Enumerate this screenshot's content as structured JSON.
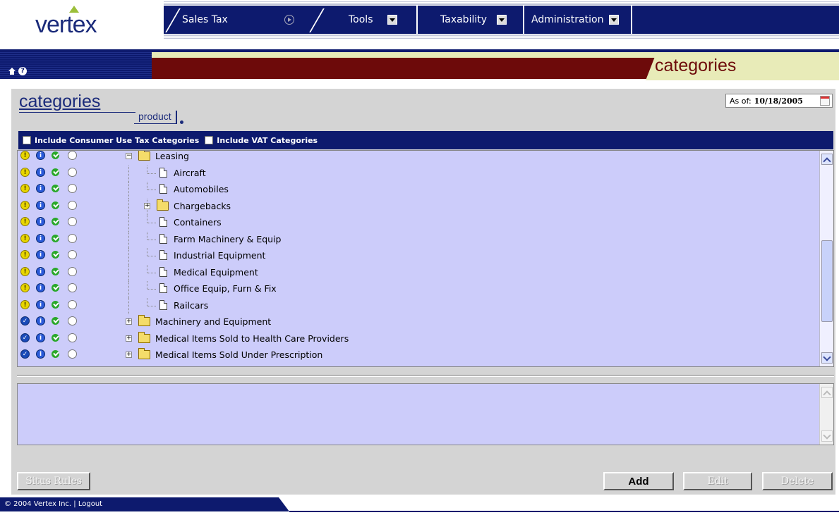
{
  "app": {
    "logo": "vertex"
  },
  "nav": {
    "items": [
      {
        "label": "Sales Tax",
        "icon": "play-circle-icon"
      },
      {
        "label": "Tools",
        "icon": "dropdown-arrow-icon"
      },
      {
        "label": "Taxability",
        "icon": "dropdown-arrow-icon"
      },
      {
        "label": "Administration",
        "icon": "dropdown-arrow-icon"
      }
    ]
  },
  "section_tab": "categories",
  "page": {
    "title": "categories",
    "subtitle": "product",
    "as_of_label": "As of:",
    "as_of_date": "10/18/2005"
  },
  "filters": {
    "consumer_use": "Include Consumer Use Tax Categories",
    "vat": "Include VAT Categories"
  },
  "tree": {
    "rows": [
      {
        "label": "Leasing",
        "type": "folder-open",
        "level": 0,
        "expander": "−",
        "state_icon": "yellow"
      },
      {
        "label": "Aircraft",
        "type": "doc",
        "level": 1,
        "state_icon": "yellow"
      },
      {
        "label": "Automobiles",
        "type": "doc",
        "level": 1,
        "state_icon": "yellow"
      },
      {
        "label": "Chargebacks",
        "type": "folder",
        "level": 1,
        "expander": "+",
        "state_icon": "yellow"
      },
      {
        "label": "Containers",
        "type": "doc",
        "level": 1,
        "state_icon": "yellow"
      },
      {
        "label": "Farm Machinery & Equip",
        "type": "doc",
        "level": 1,
        "state_icon": "yellow"
      },
      {
        "label": "Industrial Equipment",
        "type": "doc",
        "level": 1,
        "state_icon": "yellow"
      },
      {
        "label": "Medical Equipment",
        "type": "doc",
        "level": 1,
        "state_icon": "yellow"
      },
      {
        "label": "Office Equip, Furn & Fix",
        "type": "doc",
        "level": 1,
        "state_icon": "yellow"
      },
      {
        "label": "Railcars",
        "type": "doc",
        "level": 1,
        "state_icon": "yellow"
      },
      {
        "label": "Machinery and Equipment",
        "type": "folder",
        "level": 0,
        "expander": "+",
        "state_icon": "blue"
      },
      {
        "label": "Medical Items Sold to Health Care Providers",
        "type": "folder",
        "level": 0,
        "expander": "+",
        "state_icon": "blue"
      },
      {
        "label": "Medical Items Sold Under Prescription",
        "type": "folder",
        "level": 0,
        "expander": "+",
        "state_icon": "blue"
      }
    ]
  },
  "buttons": {
    "situs_rules": "Situs Rules",
    "add": "Add",
    "edit": "Edit",
    "delete": "Delete"
  },
  "footer": {
    "copyright": "© 2004 Vertex Inc.",
    "separator": "|",
    "logout": "Logout"
  },
  "colors": {
    "navy": "#0d1a6e",
    "maroon": "#6d0a0a",
    "lavender": "#ccccfa",
    "cream": "#e8ebb8"
  }
}
